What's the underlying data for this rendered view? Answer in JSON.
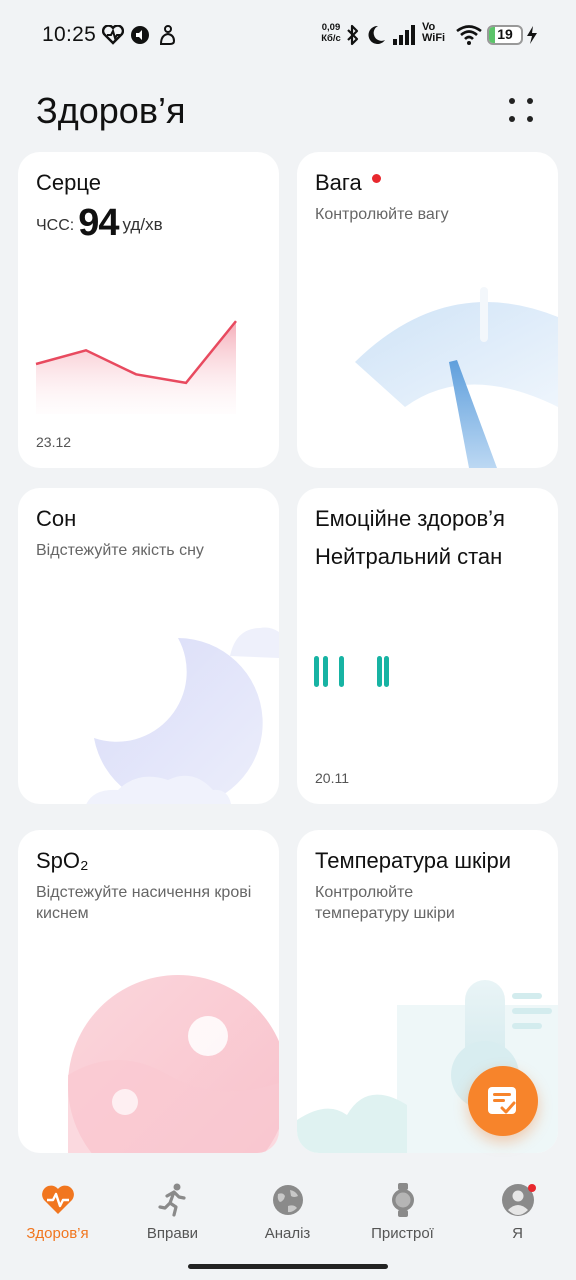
{
  "status_bar": {
    "time": "10:25",
    "speed_value": "0,09",
    "speed_unit": "Кб/с",
    "vo_label": "Vo",
    "wifi_label": "WiFi",
    "battery_level": "19",
    "battery_fraction": 0.19,
    "left_icons": [
      "heart-pulse-icon",
      "cast-icon",
      "app-notification-icon"
    ],
    "right_icons": [
      "bluetooth-icon",
      "moon-icon",
      "signal-icon",
      "wifi-icon",
      "charging-icon"
    ]
  },
  "header": {
    "title": "Здоров’я"
  },
  "cards": {
    "heart": {
      "title": "Серце",
      "hr_label": "ЧСС:",
      "hr_value": "94",
      "hr_unit": "уд/хв",
      "date": "23.12",
      "chart_points": [
        68,
        76,
        62,
        57,
        93
      ],
      "color": "#e84a5f"
    },
    "weight": {
      "title": "Вага",
      "subtitle": "Контролюйте вагу",
      "has_alert": true
    },
    "sleep": {
      "title": "Сон",
      "subtitle": "Відстежуйте якість сну"
    },
    "emotion": {
      "title": "Емоційне здоров’я",
      "state": "Нейтральний стан",
      "date": "20.11",
      "color": "#17b3a3"
    },
    "spo2": {
      "title": "SpO₂",
      "subtitle": "Відстежуйте насичення крові киснем"
    },
    "skin_temp": {
      "title": "Температура шкіри",
      "subtitle": "Контролюйте температуру шкіри"
    }
  },
  "fab": {
    "icon": "notes-check-icon",
    "color": "#f7842b"
  },
  "nav": {
    "items": [
      {
        "label": "Здоров’я",
        "icon": "health-heart-icon",
        "active": true
      },
      {
        "label": "Вправи",
        "icon": "running-icon",
        "active": false
      },
      {
        "label": "Аналіз",
        "icon": "globe-icon",
        "active": false
      },
      {
        "label": "Пристрої",
        "icon": "watch-icon",
        "active": false
      },
      {
        "label": "Я",
        "icon": "profile-icon",
        "active": false,
        "has_alert": true
      }
    ],
    "active_color": "#f1761f"
  }
}
